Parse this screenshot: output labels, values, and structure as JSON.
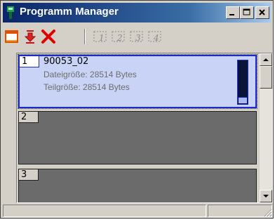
{
  "window": {
    "title": "Programm Manager"
  },
  "toolbar": {
    "buttons": [
      "window-frame-icon",
      "download-icon",
      "delete-icon",
      "slot-1-icon",
      "slot-2-icon",
      "slot-3-icon",
      "slot-4-icon"
    ],
    "slot_labels": [
      "1",
      "2",
      "3",
      "4"
    ]
  },
  "slots": [
    {
      "number": "1",
      "name": "90053_02",
      "file_size": "Dateigröße: 28514 Bytes",
      "part_size": "Teilgröße: 28514 Bytes",
      "selected": true
    },
    {
      "number": "2",
      "name": ""
    },
    {
      "number": "3",
      "name": ""
    }
  ],
  "colors": {
    "title_start": "#0a246a",
    "title_end": "#a6caf0",
    "selection_border": "#1c2bd0",
    "empty_slot": "#6b6b6b"
  }
}
